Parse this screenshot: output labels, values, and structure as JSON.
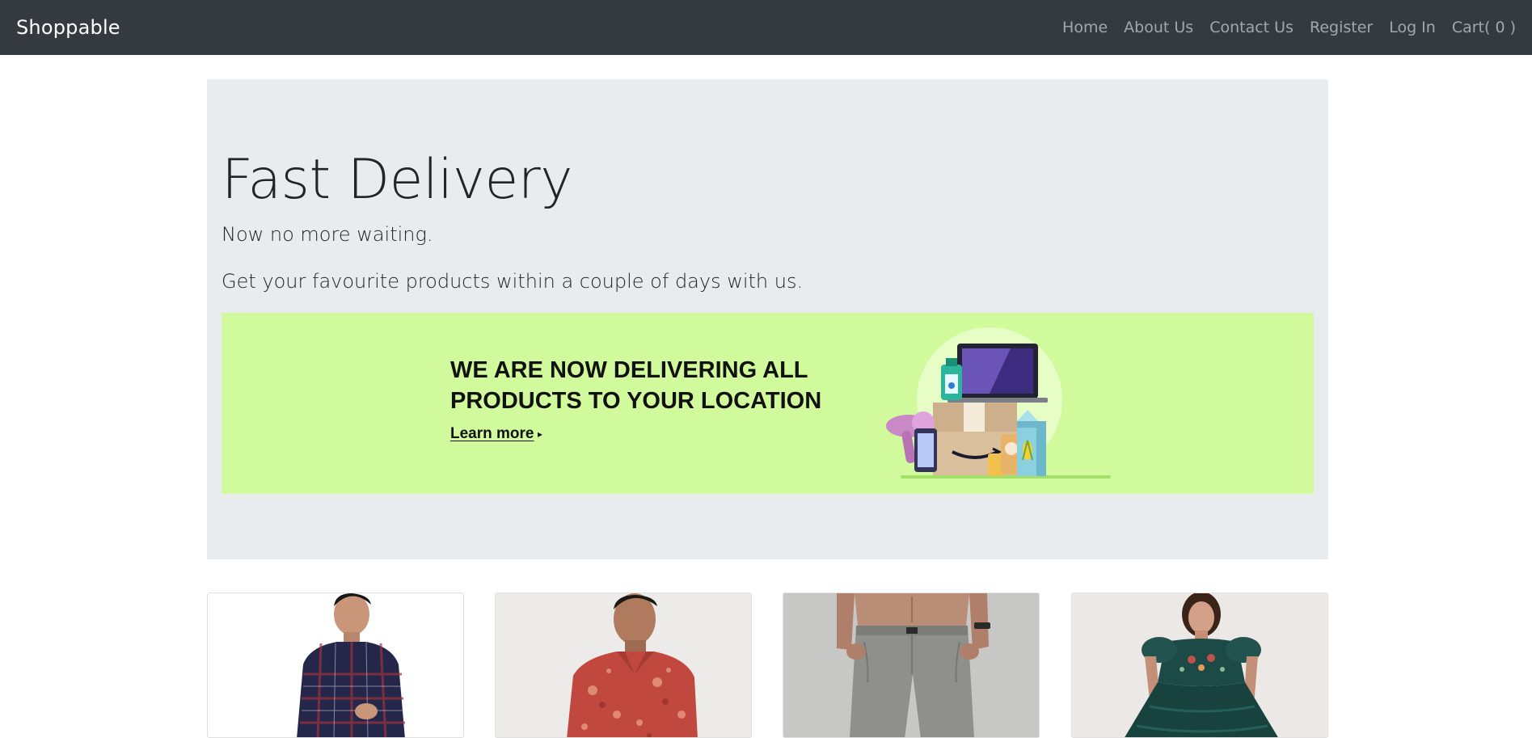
{
  "navbar": {
    "brand": "Shoppable",
    "links": [
      "Home",
      "About Us",
      "Contact Us",
      "Register",
      "Log In",
      "Cart( 0 )"
    ]
  },
  "jumbotron": {
    "title": "Fast Delivery",
    "lead1": "Now no more waiting.",
    "lead2": "Get your favourite products within a couple of days with us."
  },
  "banner": {
    "headline_line1": "WE ARE NOW DELIVERING ALL",
    "headline_line2": "PRODUCTS TO YOUR LOCATION",
    "learn_more": "Learn more",
    "arrow": "▸",
    "background_color": "#d1fa9c"
  },
  "products": [
    {
      "image": "man-checked-shirt"
    },
    {
      "image": "man-red-floral-shirt"
    },
    {
      "image": "man-grey-trousers"
    },
    {
      "image": "woman-green-dress"
    }
  ],
  "colors": {
    "navbar_bg": "#343a40",
    "jumbotron_bg": "#e9ecef"
  }
}
